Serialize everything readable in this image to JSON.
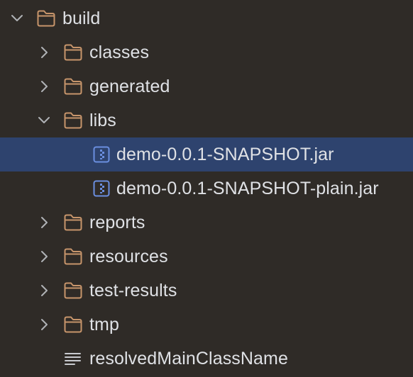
{
  "colors": {
    "background": "#2f2b27",
    "selection": "#2e436e",
    "text": "#dfe1e5",
    "folder_icon": "#c7956b",
    "jar_icon": "#6b8fe0",
    "chevron": "#b0b2b6"
  },
  "tree": {
    "items": [
      {
        "label": "build",
        "icon": "folder-icon",
        "expanded": true
      },
      {
        "label": "classes",
        "icon": "folder-icon",
        "expanded": false
      },
      {
        "label": "generated",
        "icon": "folder-icon",
        "expanded": false
      },
      {
        "label": "libs",
        "icon": "folder-icon",
        "expanded": true
      },
      {
        "label": "demo-0.0.1-SNAPSHOT.jar",
        "icon": "jar-file-icon",
        "selected": true
      },
      {
        "label": "demo-0.0.1-SNAPSHOT-plain.jar",
        "icon": "jar-file-icon"
      },
      {
        "label": "reports",
        "icon": "folder-icon",
        "expanded": false
      },
      {
        "label": "resources",
        "icon": "folder-icon",
        "expanded": false
      },
      {
        "label": "test-results",
        "icon": "folder-icon",
        "expanded": false
      },
      {
        "label": "tmp",
        "icon": "folder-icon",
        "expanded": false
      },
      {
        "label": "resolvedMainClassName",
        "icon": "text-file-icon"
      }
    ]
  }
}
